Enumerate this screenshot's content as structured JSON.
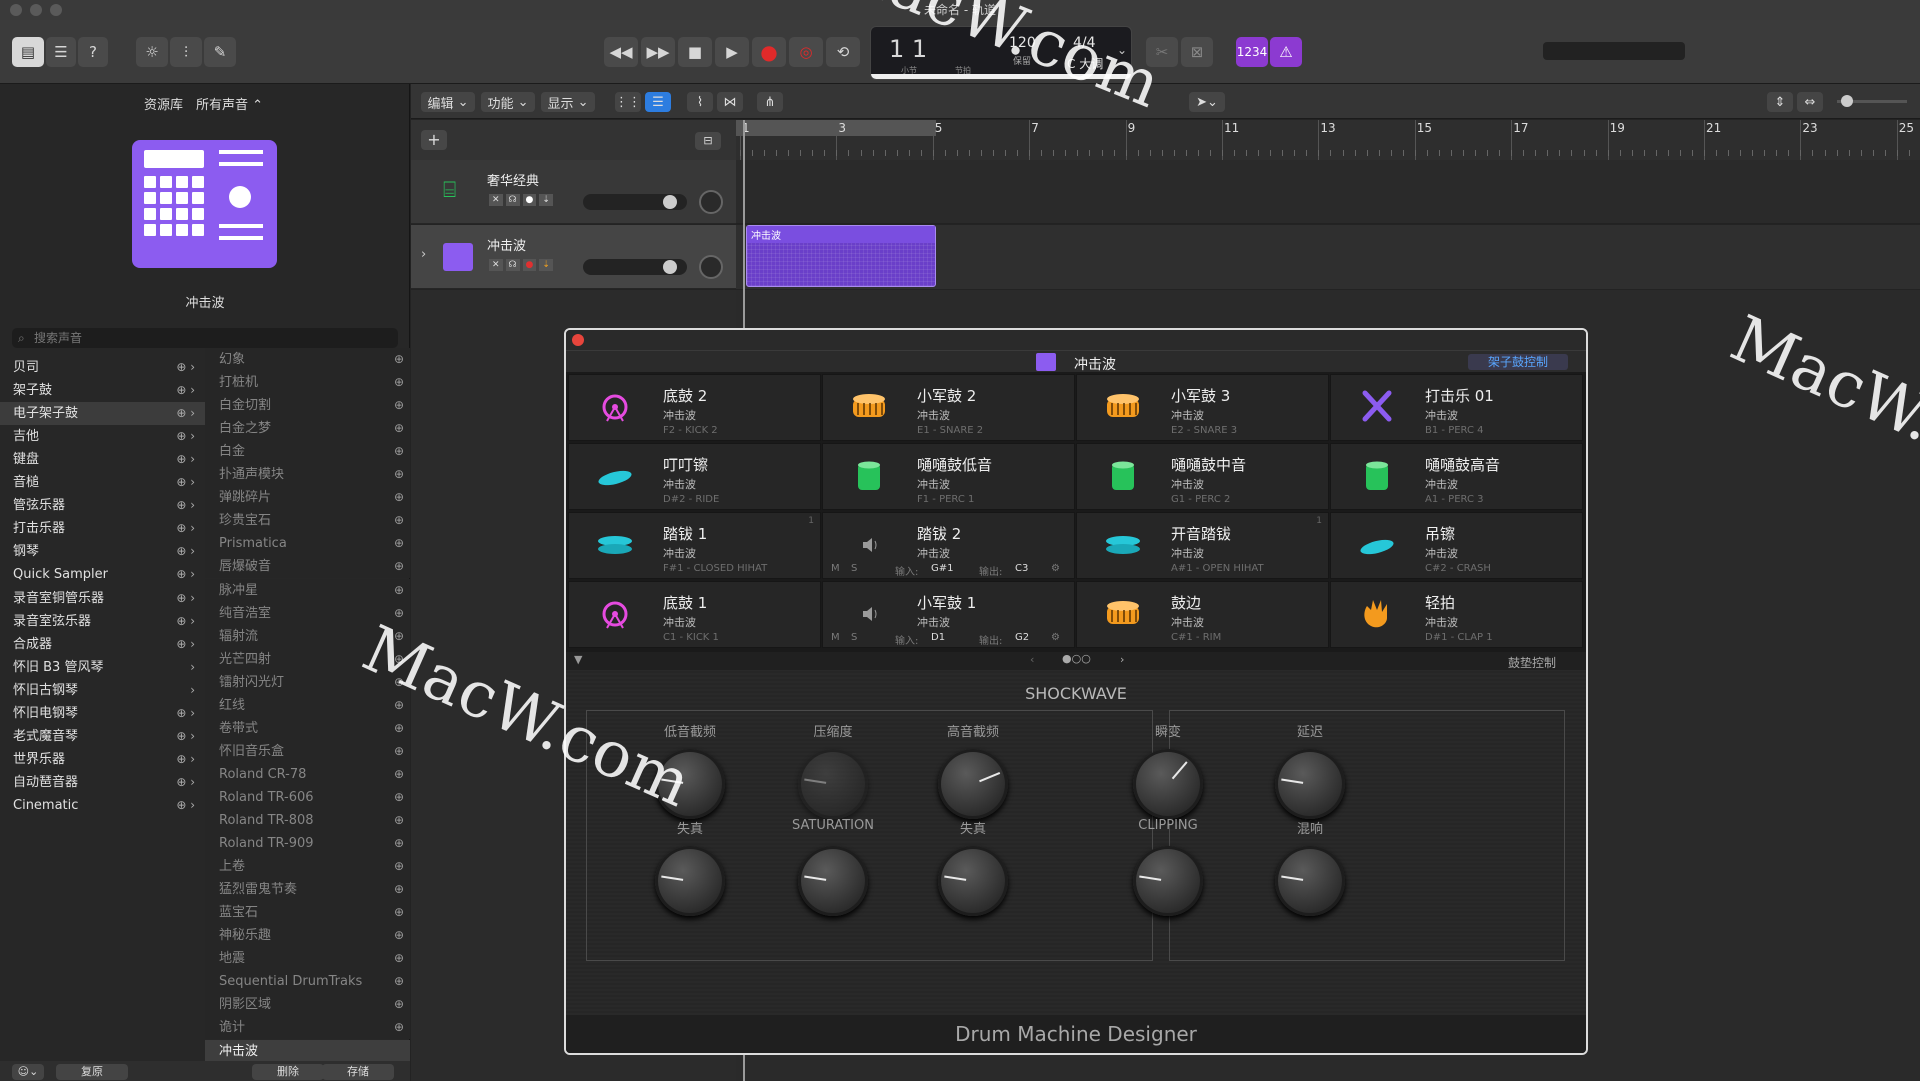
{
  "window": {
    "title": "未命名 - 轨道"
  },
  "transport": {
    "position": "1 1",
    "pos_sub_left": "小节",
    "pos_sub_right": "节拍",
    "tempo": "120",
    "tempo_label": "保留",
    "signature": "4/4",
    "key": "C 大调",
    "count_in": "1234"
  },
  "library": {
    "header_left": "资源库",
    "header_right": "所有声音 ⌃",
    "preset_name": "冲击波",
    "search_placeholder": "搜索声音",
    "categories": [
      "贝司",
      "架子鼓",
      "电子架子鼓",
      "吉他",
      "键盘",
      "音槌",
      "管弦乐器",
      "打击乐器",
      "钢琴",
      "Quick Sampler",
      "录音室铜管乐器",
      "录音室弦乐器",
      "合成器",
      "怀旧 B3 管风琴",
      "怀旧古钢琴",
      "怀旧电钢琴",
      "老式魔音琴",
      "世界乐器",
      "自动琶音器",
      "Cinematic"
    ],
    "selected_category": "电子架子鼓",
    "sounds": [
      "幻象",
      "打桩机",
      "白金切割",
      "白金之梦",
      "白金",
      "扑通声模块",
      "弹跳碎片",
      "珍贵宝石",
      "Prismatica",
      "唇爆破音",
      "脉冲星",
      "纯音浩室",
      "辐射流",
      "光芒四射",
      "镭射闪光灯",
      "红线",
      "卷带式",
      "怀旧音乐盒",
      "Roland CR-78",
      "Roland TR-606",
      "Roland TR-808",
      "Roland TR-909",
      "上卷",
      "猛烈雷鬼节奏",
      "蓝宝石",
      "神秘乐趣",
      "地震",
      "Sequential DrumTraks",
      "阴影区域",
      "诡计",
      "冲击波"
    ],
    "selected_sound": "冲击波",
    "buttons": {
      "revert": "复原",
      "delete": "删除",
      "save": "存储"
    }
  },
  "track_menu": {
    "edit": "编辑",
    "functions": "功能",
    "view": "显示"
  },
  "ruler": {
    "marks": [
      "1",
      "3",
      "5",
      "7",
      "9",
      "11",
      "13",
      "15",
      "17",
      "19",
      "21",
      "23",
      "25"
    ]
  },
  "tracks": [
    {
      "name": "奢华经典"
    },
    {
      "name": "冲击波"
    }
  ],
  "region": {
    "name": "冲击波"
  },
  "dmd": {
    "title": "冲击波",
    "kit_control": "架子鼓控制",
    "pad_control": "鼓垫控制",
    "pads": [
      {
        "name": "底鼓 2",
        "kit": "冲击波",
        "note": "F2 - KICK 2",
        "icon": "kick-icon"
      },
      {
        "name": "小军鼓 2",
        "kit": "冲击波",
        "note": "E1 - SNARE 2",
        "icon": "snare-icon"
      },
      {
        "name": "小军鼓 3",
        "kit": "冲击波",
        "note": "E2 - SNARE 3",
        "icon": "snare-icon"
      },
      {
        "name": "打击乐 01",
        "kit": "冲击波",
        "note": "B1 - PERC 4",
        "icon": "sticks-icon"
      },
      {
        "name": "叮叮镲",
        "kit": "冲击波",
        "note": "D#2 - RIDE",
        "icon": "cymbal-icon"
      },
      {
        "name": "嗵嗵鼓低音",
        "kit": "冲击波",
        "note": "F1 - PERC 1",
        "icon": "tom-icon"
      },
      {
        "name": "嗵嗵鼓中音",
        "kit": "冲击波",
        "note": "G1 - PERC 2",
        "icon": "tom-icon"
      },
      {
        "name": "嗵嗵鼓高音",
        "kit": "冲击波",
        "note": "A1 - PERC 3",
        "icon": "tom-icon"
      },
      {
        "name": "踏钹 1",
        "kit": "冲击波",
        "note": "F#1 - CLOSED HIHAT",
        "icon": "hihat-icon"
      },
      {
        "name": "踏钹 2",
        "kit": "冲击波",
        "note": "",
        "icon": "speaker-icon",
        "input": "G#1",
        "output": "C3"
      },
      {
        "name": "开音踏钹",
        "kit": "冲击波",
        "note": "A#1 - OPEN HIHAT",
        "icon": "hihat-icon"
      },
      {
        "name": "吊镲",
        "kit": "冲击波",
        "note": "C#2 - CRASH",
        "icon": "cymbal-icon"
      },
      {
        "name": "底鼓 1",
        "kit": "冲击波",
        "note": "C1 - KICK 1",
        "icon": "kick-icon"
      },
      {
        "name": "小军鼓 1",
        "kit": "冲击波",
        "note": "",
        "icon": "speaker-icon",
        "input": "D1",
        "output": "G2"
      },
      {
        "name": "鼓边",
        "kit": "冲击波",
        "note": "C#1 - RIM",
        "icon": "snare-icon"
      },
      {
        "name": "轻拍",
        "kit": "冲击波",
        "note": "D#1 - CLAP 1",
        "icon": "clap-icon"
      }
    ],
    "ms": {
      "m": "M",
      "s": "S",
      "input_label": "输入:",
      "output_label": "输出:"
    },
    "group_marks": [
      "1",
      "1"
    ],
    "synth_title": "SHOCKWAVE",
    "knobs": [
      {
        "label": "低音截频",
        "value": 0.2
      },
      {
        "label": "压缩度",
        "value": 0.2
      },
      {
        "label": "高音截频",
        "value": 0.75
      },
      {
        "label": "失真",
        "value": 0.2
      },
      {
        "label": "SATURATION",
        "value": 0.2
      },
      {
        "label": "失真",
        "value": 0.2
      },
      {
        "label": "瞬变",
        "value": 0.65
      },
      {
        "label": "延迟",
        "value": 0.2
      },
      {
        "label": "CLIPPING",
        "value": 0.2
      },
      {
        "label": "混响",
        "value": 0.2
      }
    ],
    "footer": "Drum Machine Designer"
  },
  "watermark": "MacW.com",
  "colors": {
    "purple": "#8c5cf0",
    "orange": "#f39a1e",
    "green": "#27c25a",
    "cyan": "#26c7d8",
    "magenta": "#e64be0",
    "accent": "#8c3ad1"
  }
}
